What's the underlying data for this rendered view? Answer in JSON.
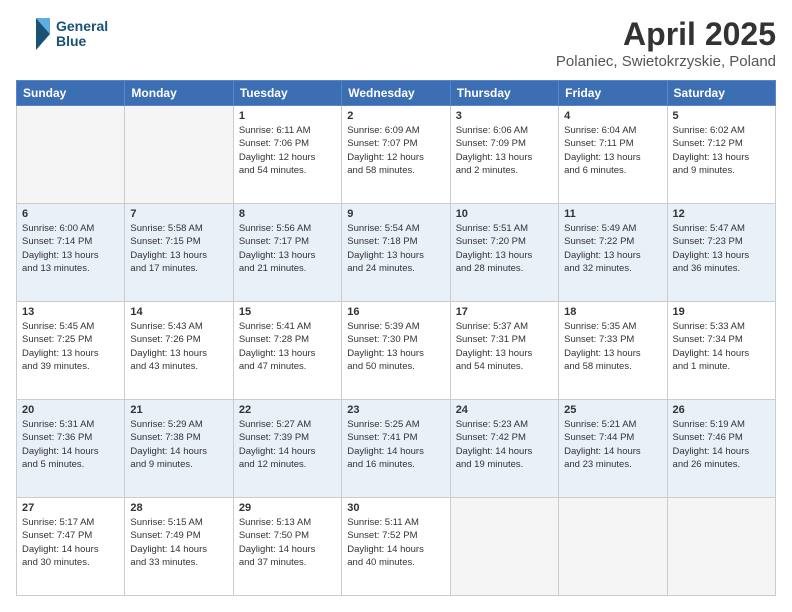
{
  "header": {
    "logo_line1": "General",
    "logo_line2": "Blue",
    "month": "April 2025",
    "location": "Polaniec, Swietokrzyskie, Poland"
  },
  "weekdays": [
    "Sunday",
    "Monday",
    "Tuesday",
    "Wednesday",
    "Thursday",
    "Friday",
    "Saturday"
  ],
  "weeks": [
    [
      {
        "num": "",
        "info": ""
      },
      {
        "num": "",
        "info": ""
      },
      {
        "num": "1",
        "info": "Sunrise: 6:11 AM\nSunset: 7:06 PM\nDaylight: 12 hours\nand 54 minutes."
      },
      {
        "num": "2",
        "info": "Sunrise: 6:09 AM\nSunset: 7:07 PM\nDaylight: 12 hours\nand 58 minutes."
      },
      {
        "num": "3",
        "info": "Sunrise: 6:06 AM\nSunset: 7:09 PM\nDaylight: 13 hours\nand 2 minutes."
      },
      {
        "num": "4",
        "info": "Sunrise: 6:04 AM\nSunset: 7:11 PM\nDaylight: 13 hours\nand 6 minutes."
      },
      {
        "num": "5",
        "info": "Sunrise: 6:02 AM\nSunset: 7:12 PM\nDaylight: 13 hours\nand 9 minutes."
      }
    ],
    [
      {
        "num": "6",
        "info": "Sunrise: 6:00 AM\nSunset: 7:14 PM\nDaylight: 13 hours\nand 13 minutes."
      },
      {
        "num": "7",
        "info": "Sunrise: 5:58 AM\nSunset: 7:15 PM\nDaylight: 13 hours\nand 17 minutes."
      },
      {
        "num": "8",
        "info": "Sunrise: 5:56 AM\nSunset: 7:17 PM\nDaylight: 13 hours\nand 21 minutes."
      },
      {
        "num": "9",
        "info": "Sunrise: 5:54 AM\nSunset: 7:18 PM\nDaylight: 13 hours\nand 24 minutes."
      },
      {
        "num": "10",
        "info": "Sunrise: 5:51 AM\nSunset: 7:20 PM\nDaylight: 13 hours\nand 28 minutes."
      },
      {
        "num": "11",
        "info": "Sunrise: 5:49 AM\nSunset: 7:22 PM\nDaylight: 13 hours\nand 32 minutes."
      },
      {
        "num": "12",
        "info": "Sunrise: 5:47 AM\nSunset: 7:23 PM\nDaylight: 13 hours\nand 36 minutes."
      }
    ],
    [
      {
        "num": "13",
        "info": "Sunrise: 5:45 AM\nSunset: 7:25 PM\nDaylight: 13 hours\nand 39 minutes."
      },
      {
        "num": "14",
        "info": "Sunrise: 5:43 AM\nSunset: 7:26 PM\nDaylight: 13 hours\nand 43 minutes."
      },
      {
        "num": "15",
        "info": "Sunrise: 5:41 AM\nSunset: 7:28 PM\nDaylight: 13 hours\nand 47 minutes."
      },
      {
        "num": "16",
        "info": "Sunrise: 5:39 AM\nSunset: 7:30 PM\nDaylight: 13 hours\nand 50 minutes."
      },
      {
        "num": "17",
        "info": "Sunrise: 5:37 AM\nSunset: 7:31 PM\nDaylight: 13 hours\nand 54 minutes."
      },
      {
        "num": "18",
        "info": "Sunrise: 5:35 AM\nSunset: 7:33 PM\nDaylight: 13 hours\nand 58 minutes."
      },
      {
        "num": "19",
        "info": "Sunrise: 5:33 AM\nSunset: 7:34 PM\nDaylight: 14 hours\nand 1 minute."
      }
    ],
    [
      {
        "num": "20",
        "info": "Sunrise: 5:31 AM\nSunset: 7:36 PM\nDaylight: 14 hours\nand 5 minutes."
      },
      {
        "num": "21",
        "info": "Sunrise: 5:29 AM\nSunset: 7:38 PM\nDaylight: 14 hours\nand 9 minutes."
      },
      {
        "num": "22",
        "info": "Sunrise: 5:27 AM\nSunset: 7:39 PM\nDaylight: 14 hours\nand 12 minutes."
      },
      {
        "num": "23",
        "info": "Sunrise: 5:25 AM\nSunset: 7:41 PM\nDaylight: 14 hours\nand 16 minutes."
      },
      {
        "num": "24",
        "info": "Sunrise: 5:23 AM\nSunset: 7:42 PM\nDaylight: 14 hours\nand 19 minutes."
      },
      {
        "num": "25",
        "info": "Sunrise: 5:21 AM\nSunset: 7:44 PM\nDaylight: 14 hours\nand 23 minutes."
      },
      {
        "num": "26",
        "info": "Sunrise: 5:19 AM\nSunset: 7:46 PM\nDaylight: 14 hours\nand 26 minutes."
      }
    ],
    [
      {
        "num": "27",
        "info": "Sunrise: 5:17 AM\nSunset: 7:47 PM\nDaylight: 14 hours\nand 30 minutes."
      },
      {
        "num": "28",
        "info": "Sunrise: 5:15 AM\nSunset: 7:49 PM\nDaylight: 14 hours\nand 33 minutes."
      },
      {
        "num": "29",
        "info": "Sunrise: 5:13 AM\nSunset: 7:50 PM\nDaylight: 14 hours\nand 37 minutes."
      },
      {
        "num": "30",
        "info": "Sunrise: 5:11 AM\nSunset: 7:52 PM\nDaylight: 14 hours\nand 40 minutes."
      },
      {
        "num": "",
        "info": ""
      },
      {
        "num": "",
        "info": ""
      },
      {
        "num": "",
        "info": ""
      }
    ]
  ]
}
